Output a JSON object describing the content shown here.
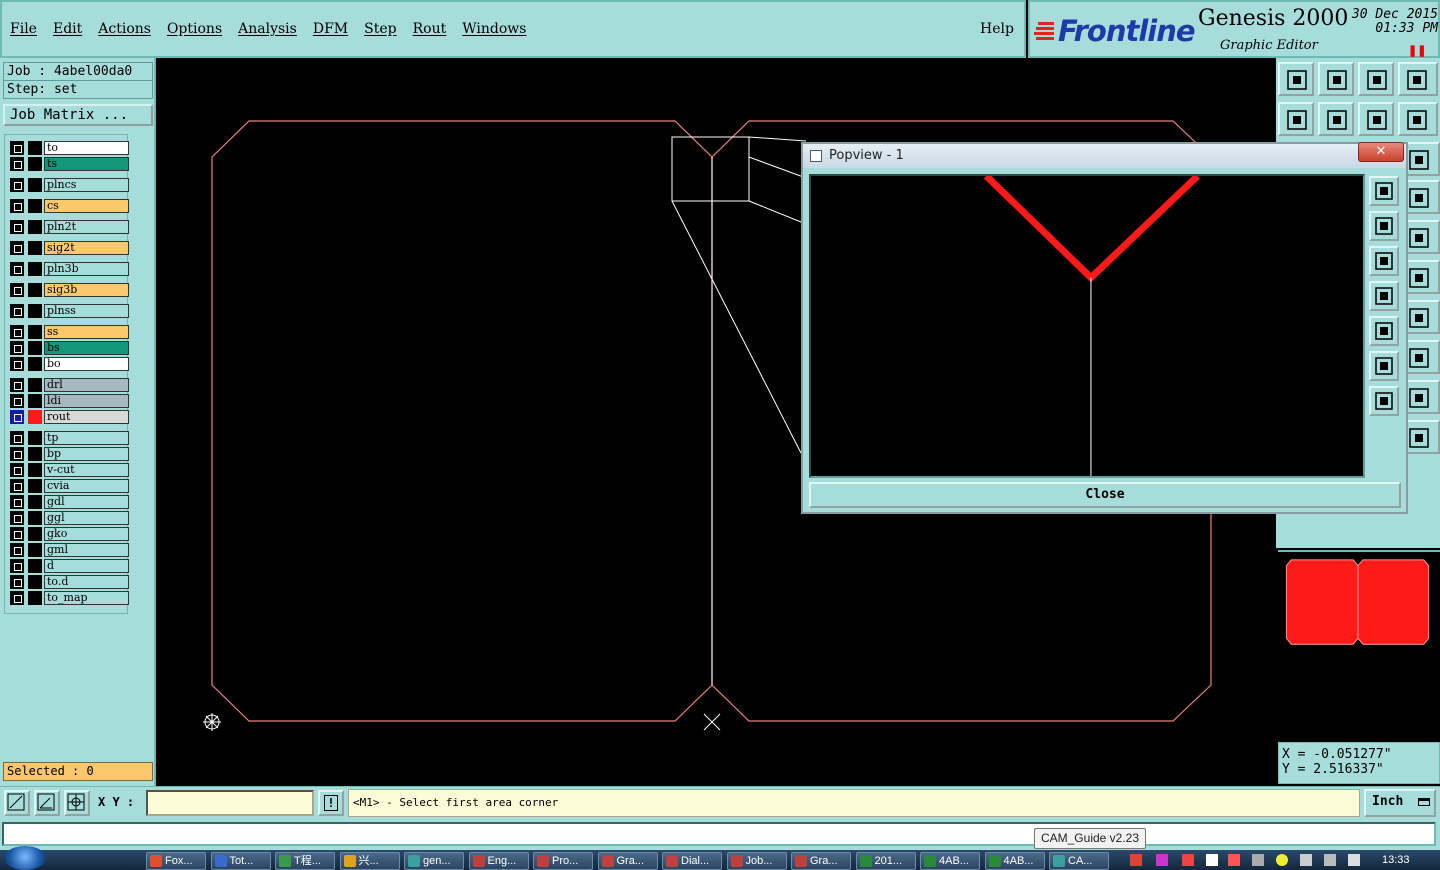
{
  "menu": {
    "items": [
      "File",
      "Edit",
      "Actions",
      "Options",
      "Analysis",
      "DFM",
      "Step",
      "Rout",
      "Windows"
    ],
    "help": "Help"
  },
  "brand": {
    "logo": "Frontline",
    "product": "Genesis 2000",
    "subtitle": "Graphic Editor",
    "date": "30 Dec 2015",
    "time": "01:33 PM"
  },
  "job": {
    "job_label": "Job : 4abel00da0",
    "step_label": "Step: set",
    "matrix_button": "Job Matrix ..."
  },
  "layers": [
    {
      "name": "to",
      "color": "#ffffff"
    },
    {
      "name": "ts",
      "color": "#14967a"
    },
    {
      "name": "plncs",
      "color": "#a6dcd9"
    },
    {
      "name": "cs",
      "color": "#f8c86a"
    },
    {
      "name": "pln2t",
      "color": "#a6dcd9"
    },
    {
      "name": "sig2t",
      "color": "#f8c86a"
    },
    {
      "name": "pln3b",
      "color": "#a6dcd9"
    },
    {
      "name": "sig3b",
      "color": "#f8c86a"
    },
    {
      "name": "plnss",
      "color": "#a6dcd9"
    },
    {
      "name": "ss",
      "color": "#f8c86a"
    },
    {
      "name": "bs",
      "color": "#14967a"
    },
    {
      "name": "bo",
      "color": "#ffffff"
    },
    {
      "name": "drl",
      "color": "#a8b8c0"
    },
    {
      "name": "ldi",
      "color": "#a8b8c0"
    },
    {
      "name": "rout",
      "color": "#d9d9d9",
      "active": true
    },
    {
      "name": "tp",
      "color": "#a6dcd9"
    },
    {
      "name": "bp",
      "color": "#a6dcd9"
    },
    {
      "name": "v-cut",
      "color": "#a6dcd9"
    },
    {
      "name": "cvia",
      "color": "#a6dcd9"
    },
    {
      "name": "gdl",
      "color": "#a6dcd9"
    },
    {
      "name": "ggl",
      "color": "#a6dcd9"
    },
    {
      "name": "gko",
      "color": "#a6dcd9"
    },
    {
      "name": "gml",
      "color": "#a6dcd9"
    },
    {
      "name": "d",
      "color": "#a6dcd9"
    },
    {
      "name": "to.d",
      "color": "#a6dcd9"
    },
    {
      "name": "to_map",
      "color": "#a6dcd9"
    }
  ],
  "status": {
    "selected": "Selected : 0",
    "x": "X = -0.051277\"",
    "y": "Y = 2.516337\""
  },
  "popview": {
    "title": "Popview - 1",
    "close_x": "✕",
    "close_button": "Close"
  },
  "command": {
    "xy_label": "X Y :",
    "xy_value": "",
    "bang": "!",
    "prompt": "<M1> - Select first area corner",
    "unit": "Inch"
  },
  "tooltip": "CAM_Guide v2.23",
  "taskbar": {
    "tasks": [
      "Fox...",
      "Tot...",
      "T程...",
      "兴...",
      "gen...",
      "Eng...",
      "Pro...",
      "Gra...",
      "Dial...",
      "Job...",
      "Gra...",
      "201...",
      "4AB...",
      "4AB...",
      "CA..."
    ],
    "clock": "13:33"
  },
  "colors": {
    "panel": "#a6dcd9",
    "rout_outline": "#e8827a",
    "highlight_red": "#ff1a1a"
  }
}
